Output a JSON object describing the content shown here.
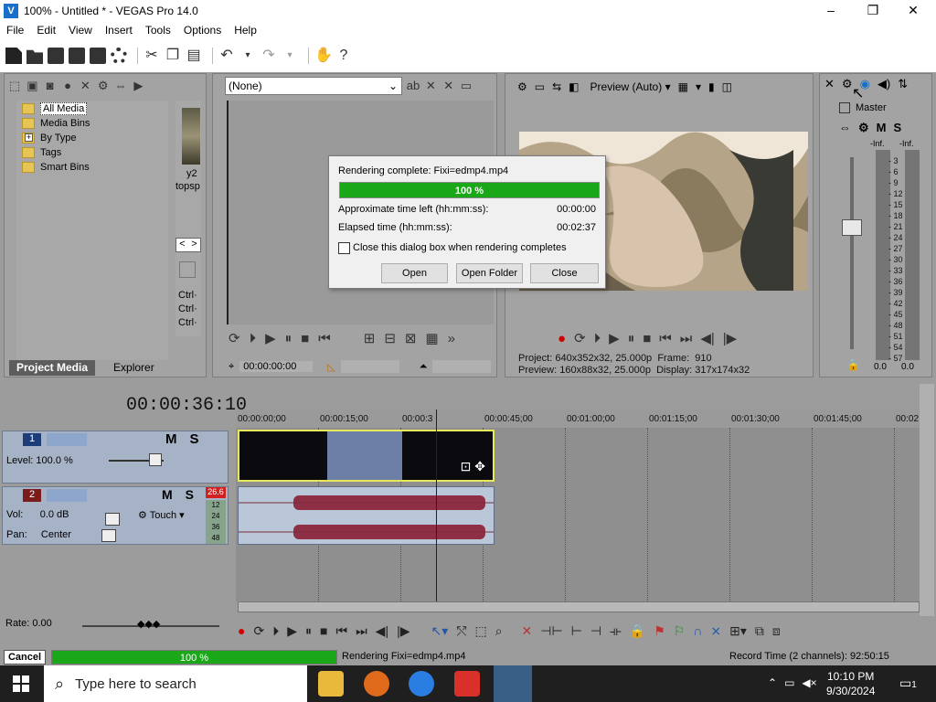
{
  "window": {
    "title": "100% - Untitled * - VEGAS Pro 14.0",
    "min": "–",
    "max": "❐",
    "close": "✕"
  },
  "menu": [
    "File",
    "Edit",
    "View",
    "Insert",
    "Tools",
    "Options",
    "Help"
  ],
  "media": {
    "tree": [
      "All Media",
      "Media Bins",
      "By Type",
      "Tags",
      "Smart Bins"
    ],
    "tabs": [
      "Project Media",
      "Explorer"
    ],
    "thumb_text": [
      "y2",
      "topsp"
    ],
    "nav": [
      "<",
      ">"
    ],
    "crtl": [
      "Ctrl·",
      "Ctrl·",
      "Ctrl·"
    ]
  },
  "trimmer": {
    "select": "(None)",
    "time": "00:00:00:00"
  },
  "preview": {
    "mode": "Preview (Auto)",
    "project_label": "Project:",
    "project_val": "640x352x32, 25.000p",
    "preview_label": "Preview:",
    "preview_val": "160x88x32, 25.000p",
    "frame_label": "Frame:",
    "frame_val": "910",
    "display_label": "Display:",
    "display_val": "317x174x32"
  },
  "mixer": {
    "label": "Master",
    "inf1": "-Inf.",
    "inf2": "-Inf.",
    "scale": [
      "3",
      "6",
      "9",
      "12",
      "15",
      "18",
      "21",
      "24",
      "27",
      "30",
      "33",
      "36",
      "39",
      "42",
      "45",
      "48",
      "51",
      "54",
      "57"
    ],
    "bottom1": "0.0",
    "bottom2": "0.0",
    "m": "M",
    "s": "S"
  },
  "dialog": {
    "title": "Rendering complete: Fixi=edmp4.mp4",
    "progress": "100 %",
    "progress_value": 1.0,
    "left_label": "Approximate time left (hh:mm:ss):",
    "left_val": "00:00:00",
    "elapsed_label": "Elapsed time (hh:mm:ss):",
    "elapsed_val": "00:02:37",
    "checkbox": "Close this dialog box when rendering completes",
    "btn_open": "Open",
    "btn_folder": "Open Folder",
    "btn_close": "Close"
  },
  "timeline": {
    "timecode": "00:00:36:10",
    "ruler": [
      "00:00:00;00",
      "00:00:15;00",
      "00:00:3",
      "00:00:45;00",
      "00:01:00;00",
      "00:01:15;00",
      "00:01:30;00",
      "00:01:45;00",
      "00:02"
    ]
  },
  "video_track": {
    "num": "1",
    "level": "Level: 100.0 %",
    "m": "M",
    "s": "S"
  },
  "audio_track": {
    "num": "2",
    "vol_label": "Vol:",
    "vol": "0.0 dB",
    "pan_label": "Pan:",
    "pan": "Center",
    "touch": "Touch",
    "peak": "26.6",
    "meter": [
      "12",
      "24",
      "36",
      "48"
    ],
    "m": "M",
    "s": "S"
  },
  "transport": {
    "rate": "Rate: 0.00"
  },
  "status": {
    "cancel": "Cancel",
    "progress": "100 %",
    "progress_value": 1.0,
    "rendering": "Rendering Fixi=edmp4.mp4",
    "record": "Record Time (2 channels): 92:50:15"
  },
  "taskbar": {
    "search": "Type here to search",
    "time": "10:10 PM",
    "date": "9/30/2024",
    "notif": "1"
  },
  "colors": {
    "progress": "#1aa818",
    "panel": "#a3a3a3"
  }
}
